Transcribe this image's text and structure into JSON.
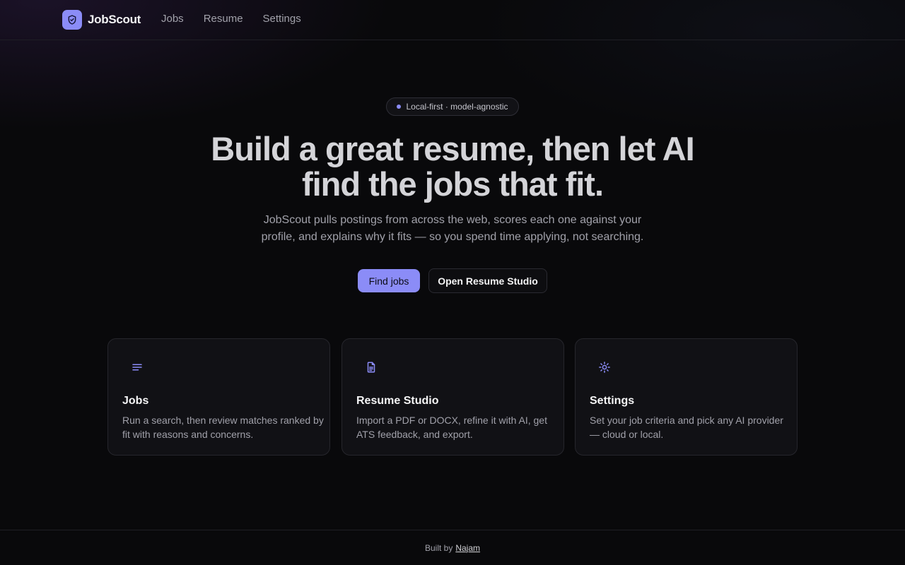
{
  "nav": {
    "brand": "JobScout",
    "links": [
      {
        "label": "Jobs"
      },
      {
        "label": "Resume"
      },
      {
        "label": "Settings"
      }
    ]
  },
  "hero": {
    "badge": "Local-first · model-agnostic",
    "headline_line1": "Build a great resume, then let AI",
    "headline_line2": "find the jobs that fit.",
    "subtitle_line1": "JobScout pulls postings from across the web, scores each one against your",
    "subtitle_line2": "profile, and explains why it fits — so you spend time applying, not searching.",
    "primary_button": "Find jobs",
    "secondary_button": "Open Resume Studio"
  },
  "cards": [
    {
      "icon": "list-icon",
      "title": "Jobs",
      "description": "Run a search, then review matches ranked by fit with reasons and concerns."
    },
    {
      "icon": "document-icon",
      "title": "Resume Studio",
      "description": "Import a PDF or DOCX, refine it with AI, get ATS feedback, and export."
    },
    {
      "icon": "sun-gear-icon",
      "title": "Settings",
      "description": "Set your job criteria and pick any AI provider — cloud or local."
    }
  ],
  "footer": {
    "prefix": "Built by",
    "author": "Najam"
  },
  "colors": {
    "accent": "#8b8cf7",
    "background": "#09090b",
    "card": "#111115"
  }
}
